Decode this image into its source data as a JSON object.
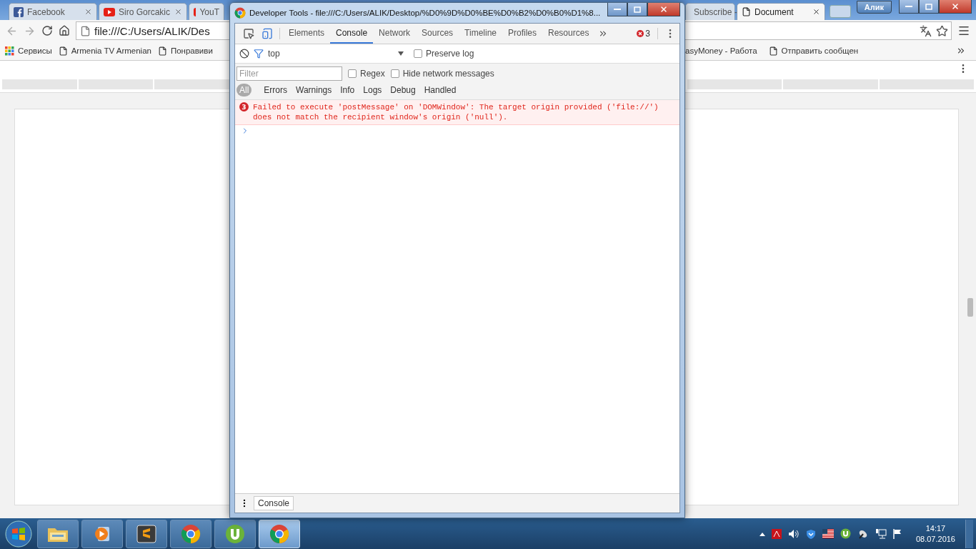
{
  "browser": {
    "tabs": [
      {
        "title": "Facebook",
        "kind": "facebook",
        "selected": false
      },
      {
        "title": "Siro Gorcakic",
        "kind": "video",
        "selected": false
      },
      {
        "title": "YouT",
        "kind": "video",
        "selected": false
      },
      {
        "title": "Subscribe -",
        "kind": "square",
        "selected": false
      },
      {
        "title": "Document",
        "kind": "page",
        "selected": true
      }
    ],
    "profile": "Алик",
    "address": "file:///C:/Users/ALIK/Des",
    "bookmarks_left": [
      {
        "label": "Сервисы",
        "kind": "apps"
      },
      {
        "label": "Armenia TV Armenian",
        "kind": "page"
      },
      {
        "label": "Понравиви",
        "kind": "page"
      }
    ],
    "bookmarks_right": [
      {
        "label": "asyMoney - Работа",
        "kind": "plain"
      },
      {
        "label": "Отправить сообщен",
        "kind": "page"
      }
    ]
  },
  "devtools": {
    "title": "Developer Tools - file:///C:/Users/ALIK/Desktop/%D0%9D%D0%BE%D0%B2%D0%B0%D1%8...",
    "panels": [
      {
        "label": "Elements",
        "selected": false
      },
      {
        "label": "Console",
        "selected": true
      },
      {
        "label": "Network",
        "selected": false
      },
      {
        "label": "Sources",
        "selected": false
      },
      {
        "label": "Timeline",
        "selected": false
      },
      {
        "label": "Profiles",
        "selected": false
      },
      {
        "label": "Resources",
        "selected": false
      }
    ],
    "error_count": "3",
    "context": "top",
    "preserve_log": {
      "label": "Preserve log",
      "checked": false
    },
    "filter": {
      "placeholder": "Filter"
    },
    "regex": {
      "label": "Regex",
      "checked": false
    },
    "hide_network": {
      "label": "Hide network messages",
      "checked": false
    },
    "levels": [
      {
        "label": "All",
        "selected": true
      },
      {
        "label": "Errors",
        "selected": false
      },
      {
        "label": "Warnings",
        "selected": false
      },
      {
        "label": "Info",
        "selected": false
      },
      {
        "label": "Logs",
        "selected": false
      },
      {
        "label": "Debug",
        "selected": false
      },
      {
        "label": "Handled",
        "selected": false
      }
    ],
    "messages": [
      {
        "kind": "error",
        "count": "3",
        "text": "Failed to execute 'postMessage' on 'DOMWindow': The target origin provided ('file://') does not match the recipient window's origin ('null')."
      }
    ],
    "drawer_tab": "Console"
  },
  "taskbar": {
    "apps": [
      {
        "kind": "explorer",
        "selected": false
      },
      {
        "kind": "media",
        "selected": false
      },
      {
        "kind": "sublime",
        "selected": false
      },
      {
        "kind": "chrome",
        "selected": false
      },
      {
        "kind": "utorrent",
        "selected": false
      },
      {
        "kind": "chrome",
        "selected": true
      }
    ],
    "time": "14:17",
    "date": "08.07.2016"
  }
}
